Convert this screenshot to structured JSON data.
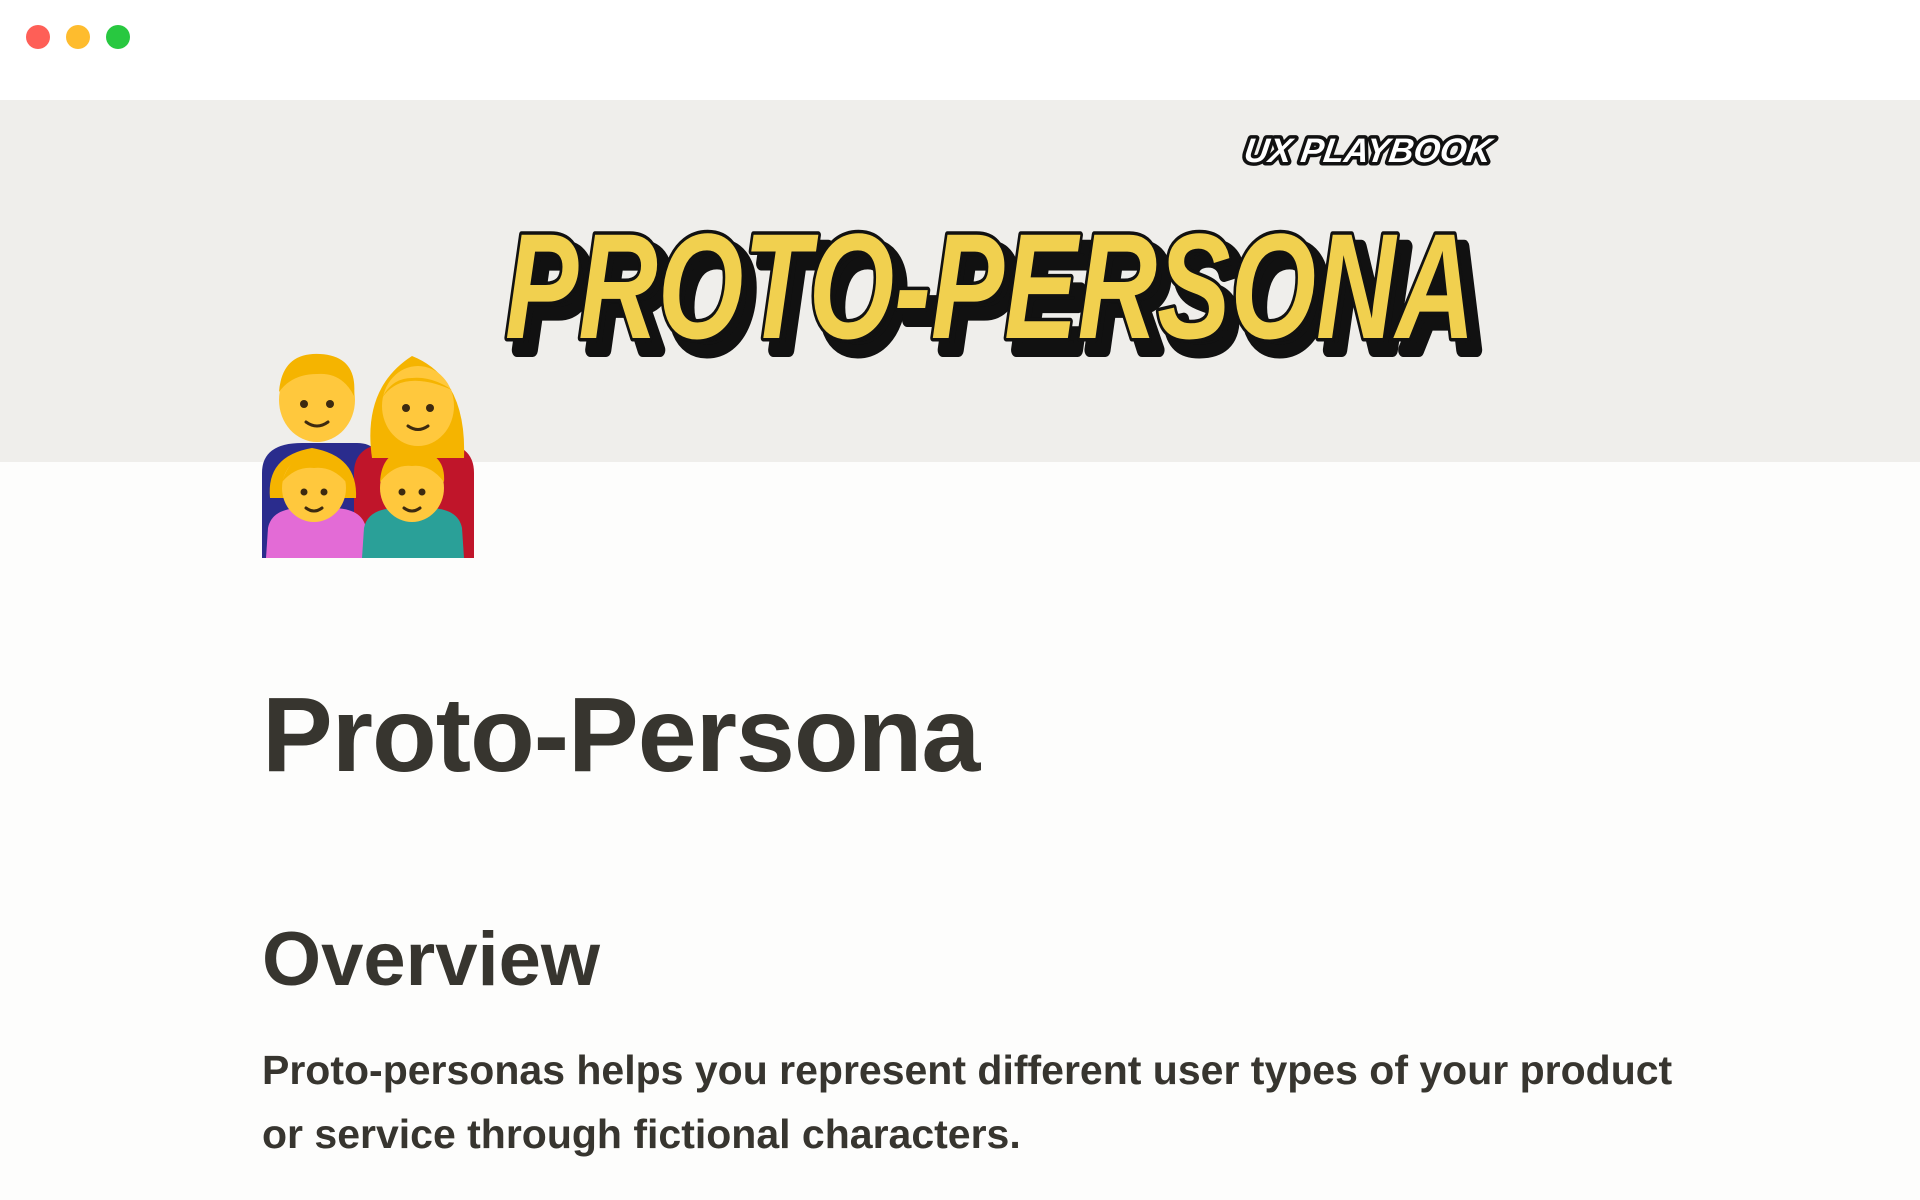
{
  "window": {
    "controls": [
      "close",
      "minimize",
      "maximize"
    ],
    "colors": {
      "close": "#fe5f57",
      "minimize": "#febc2e",
      "maximize": "#28c840"
    }
  },
  "cover": {
    "tagline": "UX PLAYBOOK",
    "headline": "PROTO-PERSONA",
    "colors": {
      "background": "#efeeeb",
      "headline_fill": "#f1d04f",
      "outline": "#111111"
    }
  },
  "page": {
    "icon": "family-icon",
    "title": "Proto-Persona",
    "sections": [
      {
        "heading": "Overview",
        "body": "Proto-personas helps you represent different user types of your product or service through fictional characters."
      }
    ]
  }
}
